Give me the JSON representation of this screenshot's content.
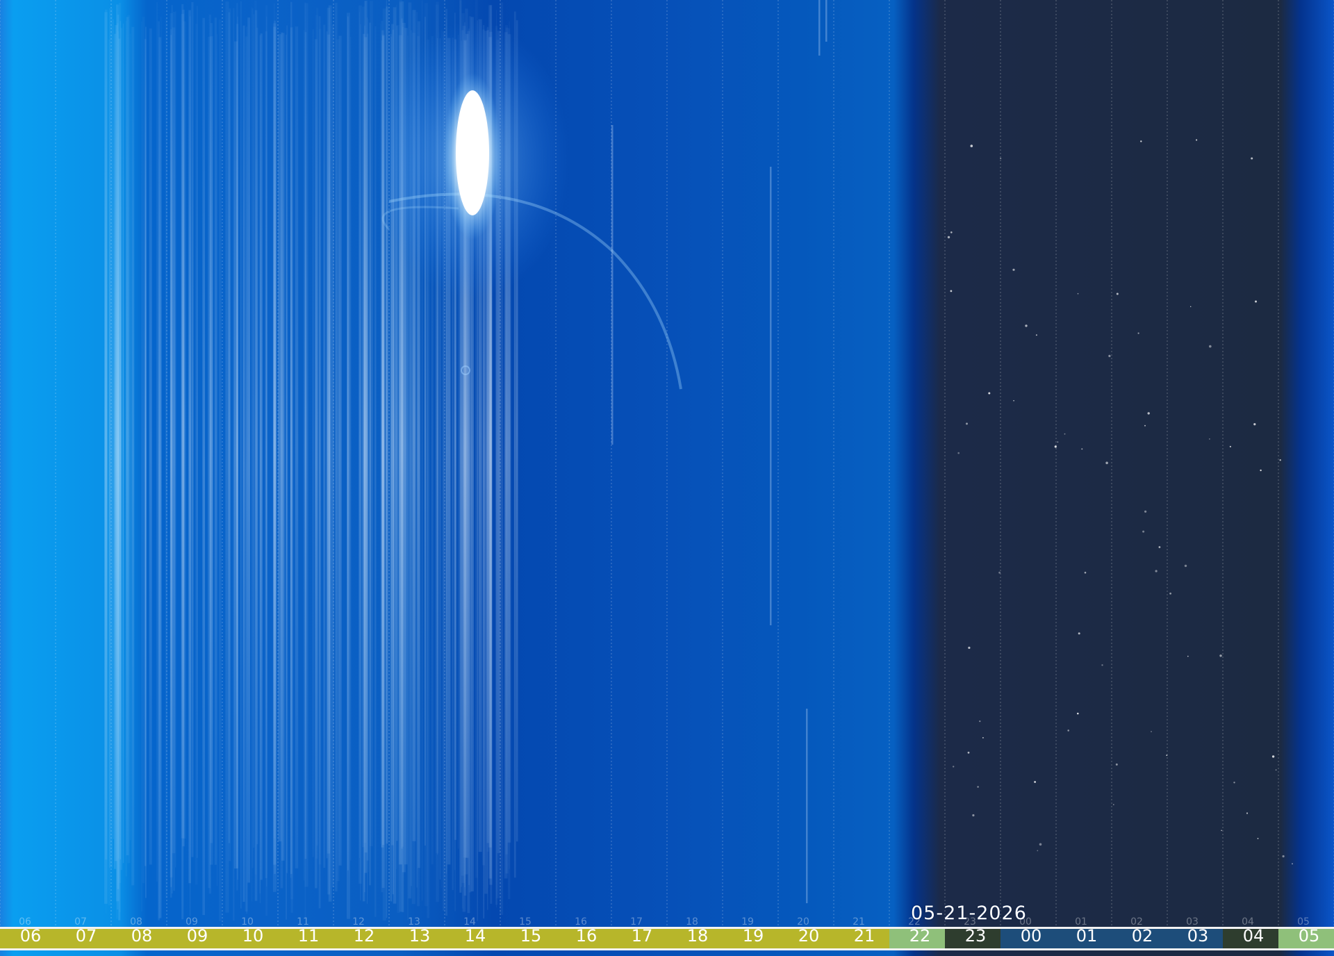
{
  "image": {
    "kind": "keogram",
    "description_visible": "24-hour sky keogram strip",
    "date_label": "05-21-2026",
    "hour_labels": [
      "06",
      "07",
      "08",
      "09",
      "10",
      "11",
      "12",
      "13",
      "14",
      "15",
      "16",
      "17",
      "18",
      "19",
      "20",
      "21",
      "22",
      "23",
      "00",
      "01",
      "02",
      "03",
      "04",
      "05"
    ],
    "colors": {
      "day_sky_light": "#0a8fe6",
      "day_sky_mid": "#0650b8",
      "dusk_blue": "#0538a8",
      "night_sky": "#1c2a40",
      "sun_white": "#ffffff",
      "bar_day": "#b7b62a",
      "bar_twilight": "#8fc07a",
      "bar_night_dark": "#2e3d2e",
      "bar_night_blue": "#1d4d7a",
      "bar_border": "#f2f2f2"
    }
  }
}
